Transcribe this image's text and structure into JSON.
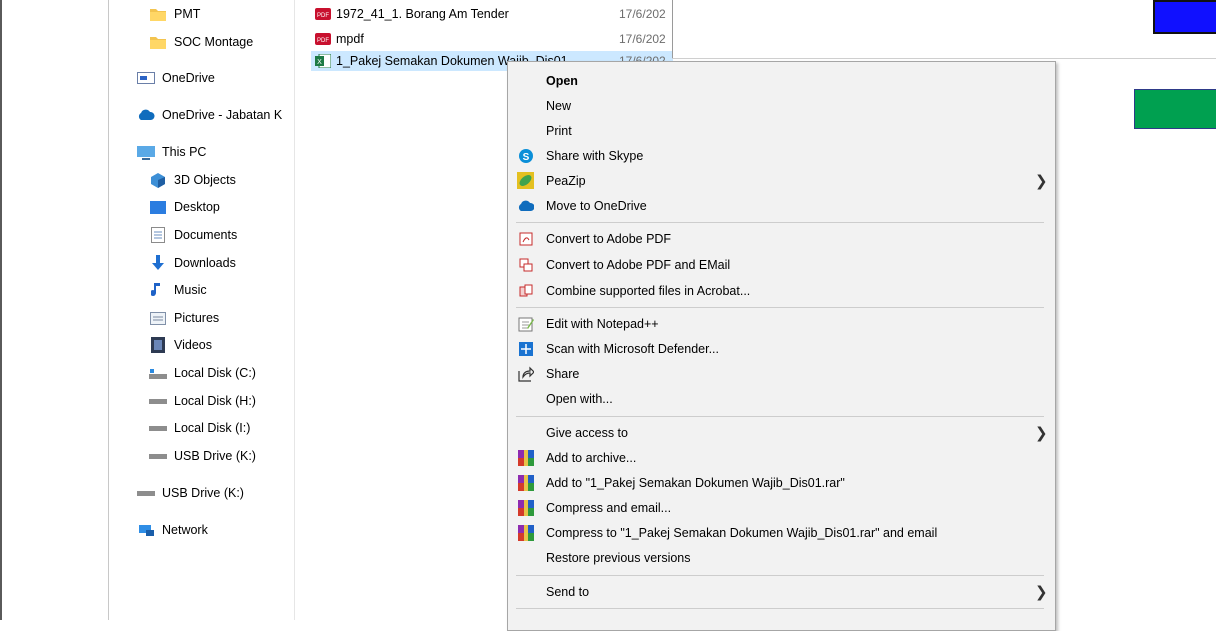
{
  "nav": {
    "items": [
      {
        "label": "PMT",
        "icon": "folder-icon"
      },
      {
        "label": "SOC Montage",
        "icon": "folder-icon"
      },
      {
        "label": "OneDrive",
        "icon": "onedrive-icon"
      },
      {
        "label": "OneDrive - Jabatan K",
        "icon": "cloud-icon"
      },
      {
        "label": "This PC",
        "icon": "computer-icon"
      },
      {
        "label": "3D Objects",
        "icon": "cube-icon"
      },
      {
        "label": "Desktop",
        "icon": "desktop-icon"
      },
      {
        "label": "Documents",
        "icon": "document-icon"
      },
      {
        "label": "Downloads",
        "icon": "download-icon"
      },
      {
        "label": "Music",
        "icon": "music-icon"
      },
      {
        "label": "Pictures",
        "icon": "pictures-icon"
      },
      {
        "label": "Videos",
        "icon": "video-icon"
      },
      {
        "label": "Local Disk (C:)",
        "icon": "drive-icon"
      },
      {
        "label": "Local Disk (H:)",
        "icon": "drive-icon"
      },
      {
        "label": "Local Disk (I:)",
        "icon": "drive-icon"
      },
      {
        "label": "USB Drive (K:)",
        "icon": "usb-drive-icon"
      },
      {
        "label": "USB Drive (K:)",
        "icon": "usb-drive-icon"
      },
      {
        "label": "Network",
        "icon": "network-icon"
      }
    ]
  },
  "files": [
    {
      "name": "1972_41_1. Borang Am Tender",
      "date": "17/6/202",
      "icon": "pdf-icon"
    },
    {
      "name": "mpdf",
      "date": "17/6/202",
      "icon": "pdf-icon"
    },
    {
      "name": "1_Pakej Semakan Dokumen Wajib_Dis01",
      "date": "17/6/202",
      "icon": "excel-icon"
    }
  ],
  "context_menu": {
    "items": [
      {
        "label": "Open",
        "bold": true
      },
      {
        "label": "New"
      },
      {
        "label": "Print"
      },
      {
        "label": "Share with Skype",
        "icon": "skype-icon"
      },
      {
        "label": "PeaZip",
        "icon": "peazip-icon",
        "submenu": true
      },
      {
        "label": "Move to OneDrive",
        "icon": "cloud-icon"
      },
      {
        "label": "Convert to Adobe PDF",
        "icon": "adobe-pdf-icon"
      },
      {
        "label": "Convert to Adobe PDF and EMail",
        "icon": "adobe-pdf-email-icon"
      },
      {
        "label": "Combine supported files in Acrobat...",
        "icon": "acrobat-combine-icon"
      },
      {
        "label": "Edit with Notepad++",
        "icon": "notepadpp-icon"
      },
      {
        "label": "Scan with Microsoft Defender...",
        "icon": "defender-icon"
      },
      {
        "label": "Share",
        "icon": "share-icon"
      },
      {
        "label": "Open with..."
      },
      {
        "label": "Give access to",
        "submenu": true
      },
      {
        "label": "Add to archive...",
        "icon": "winrar-icon"
      },
      {
        "label": "Add to \"1_Pakej Semakan Dokumen Wajib_Dis01.rar\"",
        "icon": "winrar-icon"
      },
      {
        "label": "Compress and email...",
        "icon": "winrar-icon"
      },
      {
        "label": "Compress to \"1_Pakej Semakan Dokumen Wajib_Dis01.rar\" and email",
        "icon": "winrar-icon"
      },
      {
        "label": "Restore previous versions"
      },
      {
        "label": "Send to",
        "submenu": true
      }
    ]
  },
  "colors": {
    "selection": "#cce8ff",
    "menu_bg": "#f2f2f2",
    "blue_box": "#1010ff",
    "green_box": "#00a050"
  }
}
